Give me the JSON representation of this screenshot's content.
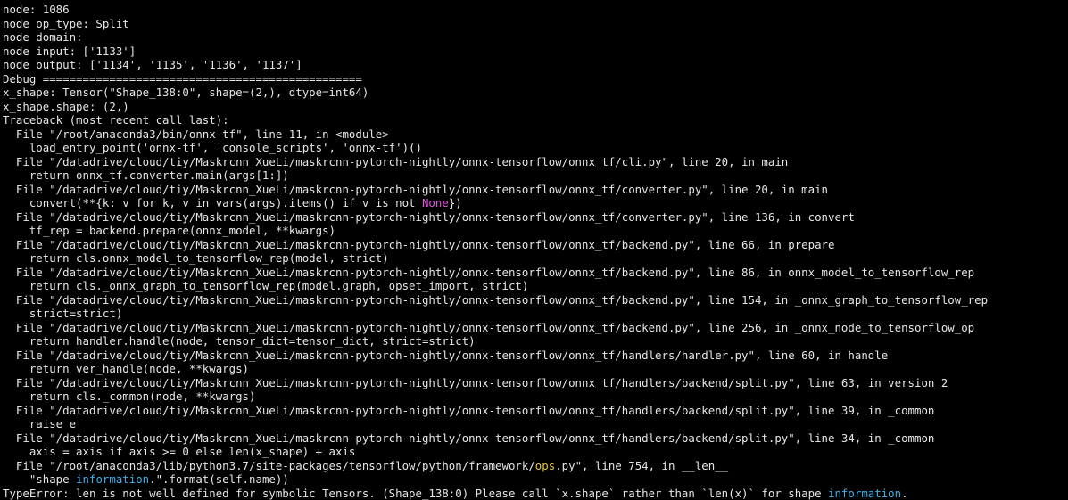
{
  "colors": {
    "background": "#000000",
    "text": "#e6e6e6",
    "keyword_none": "#e354e3",
    "module_ops": "#e5c23a",
    "builtin_information": "#3fb0e8"
  },
  "lines": [
    [
      {
        "t": "node: 1086"
      }
    ],
    [
      {
        "t": "node op_type: Split"
      }
    ],
    [
      {
        "t": "node domain:"
      }
    ],
    [
      {
        "t": "node input: ['1133']"
      }
    ],
    [
      {
        "t": "node output: ['1134', '1135', '1136', '1137']"
      }
    ],
    [
      {
        "t": "Debug ================================================"
      }
    ],
    [
      {
        "t": "x_shape: Tensor(\"Shape_138:0\", shape=(2,), dtype=int64)"
      }
    ],
    [
      {
        "t": "x_shape.shape: (2,)"
      }
    ],
    [
      {
        "t": "Traceback (most recent call last):"
      }
    ],
    [
      {
        "t": "  File \"/root/anaconda3/bin/onnx-tf\", line 11, in <module>"
      }
    ],
    [
      {
        "t": "    load_entry_point('onnx-tf', 'console_scripts', 'onnx-tf')()"
      }
    ],
    [
      {
        "t": "  File \"/datadrive/cloud/tiy/Maskrcnn_XueLi/maskrcnn-pytorch-nightly/onnx-tensorflow/onnx_tf/cli.py\", line 20, in main"
      }
    ],
    [
      {
        "t": "    return onnx_tf.converter.main(args[1:])"
      }
    ],
    [
      {
        "t": "  File \"/datadrive/cloud/tiy/Maskrcnn_XueLi/maskrcnn-pytorch-nightly/onnx-tensorflow/onnx_tf/converter.py\", line 20, in main"
      }
    ],
    [
      {
        "t": "    convert(**{k: v for k, v in vars(args).items() if v is not "
      },
      {
        "t": "None",
        "c": "hl-none"
      },
      {
        "t": "})"
      }
    ],
    [
      {
        "t": "  File \"/datadrive/cloud/tiy/Maskrcnn_XueLi/maskrcnn-pytorch-nightly/onnx-tensorflow/onnx_tf/converter.py\", line 136, in convert"
      }
    ],
    [
      {
        "t": "    tf_rep = backend.prepare(onnx_model, **kwargs)"
      }
    ],
    [
      {
        "t": "  File \"/datadrive/cloud/tiy/Maskrcnn_XueLi/maskrcnn-pytorch-nightly/onnx-tensorflow/onnx_tf/backend.py\", line 66, in prepare"
      }
    ],
    [
      {
        "t": "    return cls.onnx_model_to_tensorflow_rep(model, strict)"
      }
    ],
    [
      {
        "t": "  File \"/datadrive/cloud/tiy/Maskrcnn_XueLi/maskrcnn-pytorch-nightly/onnx-tensorflow/onnx_tf/backend.py\", line 86, in onnx_model_to_tensorflow_rep"
      }
    ],
    [
      {
        "t": "    return cls._onnx_graph_to_tensorflow_rep(model.graph, opset_import, strict)"
      }
    ],
    [
      {
        "t": "  File \"/datadrive/cloud/tiy/Maskrcnn_XueLi/maskrcnn-pytorch-nightly/onnx-tensorflow/onnx_tf/backend.py\", line 154, in _onnx_graph_to_tensorflow_rep"
      }
    ],
    [
      {
        "t": "    strict=strict)"
      }
    ],
    [
      {
        "t": "  File \"/datadrive/cloud/tiy/Maskrcnn_XueLi/maskrcnn-pytorch-nightly/onnx-tensorflow/onnx_tf/backend.py\", line 256, in _onnx_node_to_tensorflow_op"
      }
    ],
    [
      {
        "t": "    return handler.handle(node, tensor_dict=tensor_dict, strict=strict)"
      }
    ],
    [
      {
        "t": "  File \"/datadrive/cloud/tiy/Maskrcnn_XueLi/maskrcnn-pytorch-nightly/onnx-tensorflow/onnx_tf/handlers/handler.py\", line 60, in handle"
      }
    ],
    [
      {
        "t": "    return ver_handle(node, **kwargs)"
      }
    ],
    [
      {
        "t": "  File \"/datadrive/cloud/tiy/Maskrcnn_XueLi/maskrcnn-pytorch-nightly/onnx-tensorflow/onnx_tf/handlers/backend/split.py\", line 63, in version_2"
      }
    ],
    [
      {
        "t": "    return cls._common(node, **kwargs)"
      }
    ],
    [
      {
        "t": "  File \"/datadrive/cloud/tiy/Maskrcnn_XueLi/maskrcnn-pytorch-nightly/onnx-tensorflow/onnx_tf/handlers/backend/split.py\", line 39, in _common"
      }
    ],
    [
      {
        "t": "    raise e"
      }
    ],
    [
      {
        "t": "  File \"/datadrive/cloud/tiy/Maskrcnn_XueLi/maskrcnn-pytorch-nightly/onnx-tensorflow/onnx_tf/handlers/backend/split.py\", line 34, in _common"
      }
    ],
    [
      {
        "t": "    axis = axis if axis >= 0 else len(x_shape) + axis"
      }
    ],
    [
      {
        "t": "  File \"/root/anaconda3/lib/python3.7/site-packages/tensorflow/python/framework/"
      },
      {
        "t": "ops",
        "c": "hl-ops"
      },
      {
        "t": ".py\", line 754, in __len__"
      }
    ],
    [
      {
        "t": "    \"shape "
      },
      {
        "t": "information",
        "c": "hl-info"
      },
      {
        "t": ".\".format(self.name))"
      }
    ],
    [
      {
        "t": "TypeError: len is not well defined for symbolic Tensors. (Shape_138:0) Please call `x.shape` rather than `len(x)` for shape "
      },
      {
        "t": "information",
        "c": "hl-info"
      },
      {
        "t": "."
      }
    ]
  ]
}
